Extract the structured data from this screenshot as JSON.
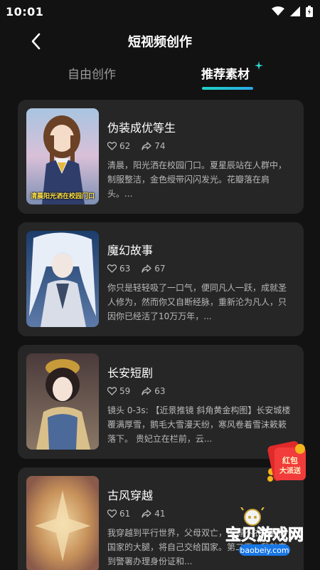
{
  "status_bar": {
    "time": "10:01",
    "icons": [
      "wifi-icon",
      "signal-icon",
      "battery-icon"
    ]
  },
  "header": {
    "title": "短视频创作",
    "back_icon": "chevron-left-icon"
  },
  "tabs": [
    {
      "label": "自由创作",
      "active": false
    },
    {
      "label": "推荐素材",
      "active": true
    }
  ],
  "accent": {
    "underline_start": "#1fd3c6",
    "underline_end": "#2aa8e8",
    "card_bg": "#262626",
    "page_bg": "#121212"
  },
  "cards": [
    {
      "title": "伪装成优等生",
      "likes": "62",
      "shares": "74",
      "desc": "清晨，阳光洒在校园门口。夏星辰站在人群中，制服整洁，金色绶带闪闪发光。花瓣落在肩头。...",
      "thumb_caption": "清晨阳光洒在校园门口"
    },
    {
      "title": "魔幻故事",
      "likes": "63",
      "shares": "67",
      "desc": "你只是轻轻吸了一口气，便同凡人一跃，成就圣人修为，然而你又自断经脉，重新沦为凡人，只因你已经活了10万万年，...",
      "thumb_caption": ""
    },
    {
      "title": "长安短剧",
      "likes": "59",
      "shares": "63",
      "desc": "镜头 0-3s: 【近景推镜 斜角黄金构图】长安城楼覆满厚雪，鹅毛大雪漫天纷，寒风卷着雪沫簌簌落下。 贵妃立在栏前，云...",
      "thumb_caption": ""
    },
    {
      "title": "古风穿越",
      "likes": "61",
      "shares": "41",
      "desc": "我穿越到平行世界，父母双亡，不得不依靠着抱国家的大腿，将自己交给国家。第二天，我就来到警署办理身份证和...",
      "thumb_caption": ""
    }
  ],
  "overlay": {
    "redpacket_top": "红包",
    "redpacket_bottom": "大派送",
    "watermark_main": "宝贝游戏网",
    "watermark_url": "baobeiy.com"
  }
}
